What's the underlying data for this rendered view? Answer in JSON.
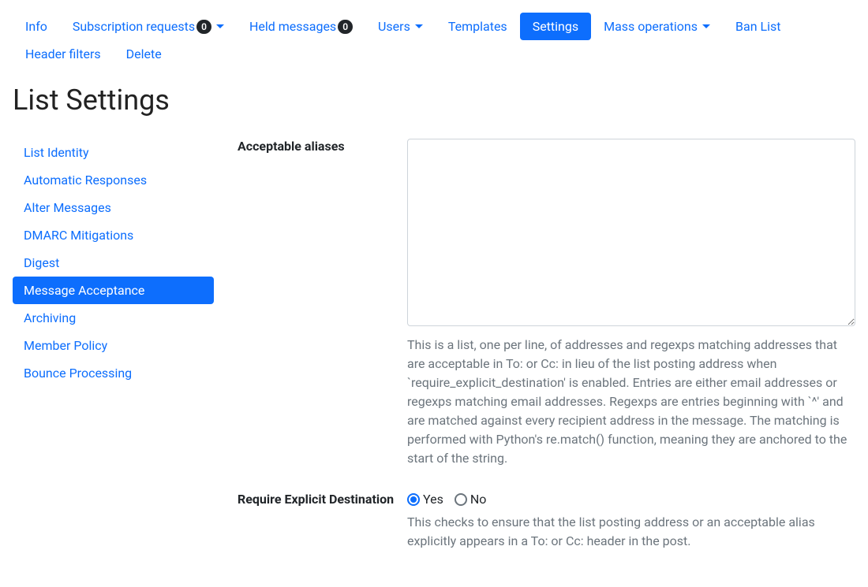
{
  "nav": {
    "info": "Info",
    "sub_requests": "Subscription requests",
    "sub_requests_badge": "0",
    "held_messages": "Held messages",
    "held_messages_badge": "0",
    "users": "Users",
    "templates": "Templates",
    "settings": "Settings",
    "mass_ops": "Mass operations",
    "ban_list": "Ban List",
    "header_filters": "Header filters",
    "delete": "Delete"
  },
  "page": {
    "title": "List Settings"
  },
  "sidebar": {
    "items": [
      "List Identity",
      "Automatic Responses",
      "Alter Messages",
      "DMARC Mitigations",
      "Digest",
      "Message Acceptance",
      "Archiving",
      "Member Policy",
      "Bounce Processing"
    ]
  },
  "form": {
    "aliases": {
      "label": "Acceptable aliases",
      "value": "",
      "help": "This is a list, one per line, of addresses and regexps matching addresses that are acceptable in To: or Cc: in lieu of the list posting address when `require_explicit_destination' is enabled. Entries are either email addresses or regexps matching email addresses. Regexps are entries beginning with `^' and are matched against every recipient address in the message. The matching is performed with Python's re.match() function, meaning they are anchored to the start of the string."
    },
    "require_dest": {
      "label": "Require Explicit Destination",
      "yes": "Yes",
      "no": "No",
      "help": "This checks to ensure that the list posting address or an acceptable alias explicitly appears in a To: or Cc: header in the post."
    }
  }
}
